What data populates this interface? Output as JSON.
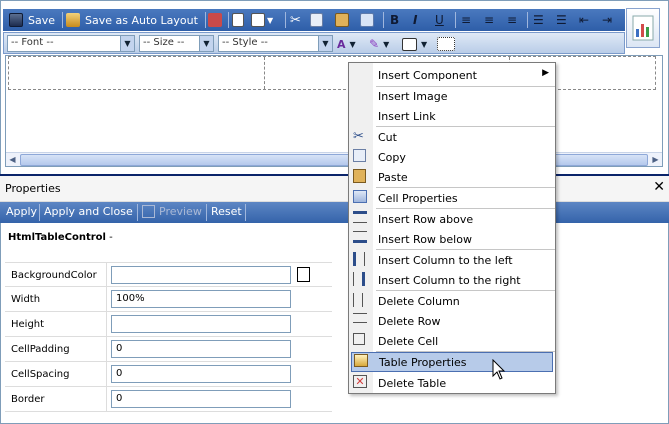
{
  "toolbar": {
    "save": "Save",
    "save_auto_layout": "Save as Auto Layout",
    "font_select": "-- Font --",
    "size_select": "-- Size --",
    "style_select": "-- Style --",
    "bold": "B",
    "italic": "I",
    "underline": "U"
  },
  "properties": {
    "title": "Properties",
    "close": "✕",
    "buttons": {
      "apply": "Apply",
      "apply_close": "Apply and Close",
      "preview": "Preview",
      "reset": "Reset"
    },
    "control": "HtmlTableControl",
    "control_suffix": " -",
    "rows": [
      {
        "label": "BackgroundColor",
        "value": ""
      },
      {
        "label": "Width",
        "value": "100%"
      },
      {
        "label": "Height",
        "value": ""
      },
      {
        "label": "CellPadding",
        "value": "0"
      },
      {
        "label": "CellSpacing",
        "value": "0"
      },
      {
        "label": "Border",
        "value": "0"
      }
    ]
  },
  "context_menu": {
    "items": [
      {
        "label": "Insert Component",
        "icon": "none",
        "submenu": true
      },
      {
        "label": "Insert Image",
        "icon": "none"
      },
      {
        "label": "Insert Link",
        "icon": "none"
      },
      {
        "label": "Cut",
        "icon": "scissors-icon"
      },
      {
        "label": "Copy",
        "icon": "copy-icon"
      },
      {
        "label": "Paste",
        "icon": "paste-icon"
      },
      {
        "label": "Cell Properties",
        "icon": "cell-properties-icon"
      },
      {
        "label": "Insert Row above",
        "icon": "insert-row-above-icon"
      },
      {
        "label": "Insert Row below",
        "icon": "insert-row-below-icon"
      },
      {
        "label": "Insert Column to the left",
        "icon": "insert-column-left-icon"
      },
      {
        "label": "Insert Column to the right",
        "icon": "insert-column-right-icon"
      },
      {
        "label": "Delete Column",
        "icon": "delete-column-icon"
      },
      {
        "label": "Delete Row",
        "icon": "delete-row-icon"
      },
      {
        "label": "Delete Cell",
        "icon": "delete-cell-icon"
      },
      {
        "label": "Table Properties",
        "icon": "table-properties-icon",
        "highlighted": true
      },
      {
        "label": "Delete Table",
        "icon": "delete-table-icon"
      }
    ]
  },
  "colors": {
    "toolbar_blue": "#2e5ea8",
    "menu_highlight": "#b7cbe9",
    "panel_border": "#0a246a"
  }
}
